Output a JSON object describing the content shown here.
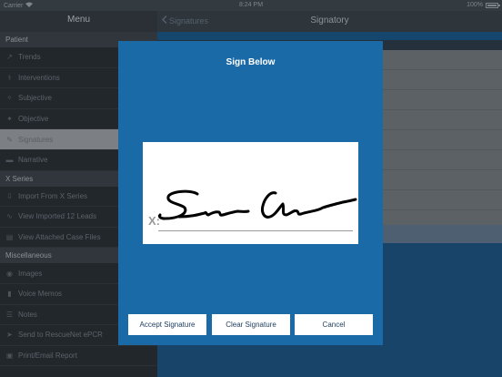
{
  "status_bar": {
    "carrier": "Carrier",
    "time": "8:24 PM",
    "battery": "100%"
  },
  "sidebar": {
    "title": "Menu",
    "sections": [
      {
        "label": "Patient",
        "items": [
          {
            "label": "Trends",
            "icon": "trends-icon"
          },
          {
            "label": "Interventions",
            "icon": "interventions-icon"
          },
          {
            "label": "Subjective",
            "icon": "subjective-icon"
          },
          {
            "label": "Objective",
            "icon": "objective-icon"
          },
          {
            "label": "Signatures",
            "icon": "pen-icon",
            "active": true
          },
          {
            "label": "Narrative",
            "icon": "speech-bubble-icon"
          }
        ]
      },
      {
        "label": "X Series",
        "items": [
          {
            "label": "Import From X Series",
            "icon": "import-icon"
          },
          {
            "label": "View Imported 12 Leads",
            "icon": "ecg-icon"
          },
          {
            "label": "View Attached Case Files",
            "icon": "files-icon"
          }
        ]
      },
      {
        "label": "Miscellaneous",
        "items": [
          {
            "label": "Images",
            "icon": "camera-icon"
          },
          {
            "label": "Voice Memos",
            "icon": "microphone-icon"
          },
          {
            "label": "Notes",
            "icon": "notes-icon"
          },
          {
            "label": "Send to RescueNet ePCR",
            "icon": "send-icon"
          },
          {
            "label": "Print/Email Report",
            "icon": "print-icon"
          }
        ]
      }
    ]
  },
  "nav": {
    "back_label": "Signatures",
    "title": "Signatory"
  },
  "modal": {
    "title": "Sign Below",
    "x_marker": "X:",
    "accept_label": "Accept Signature",
    "clear_label": "Clear Signature",
    "cancel_label": "Cancel"
  }
}
